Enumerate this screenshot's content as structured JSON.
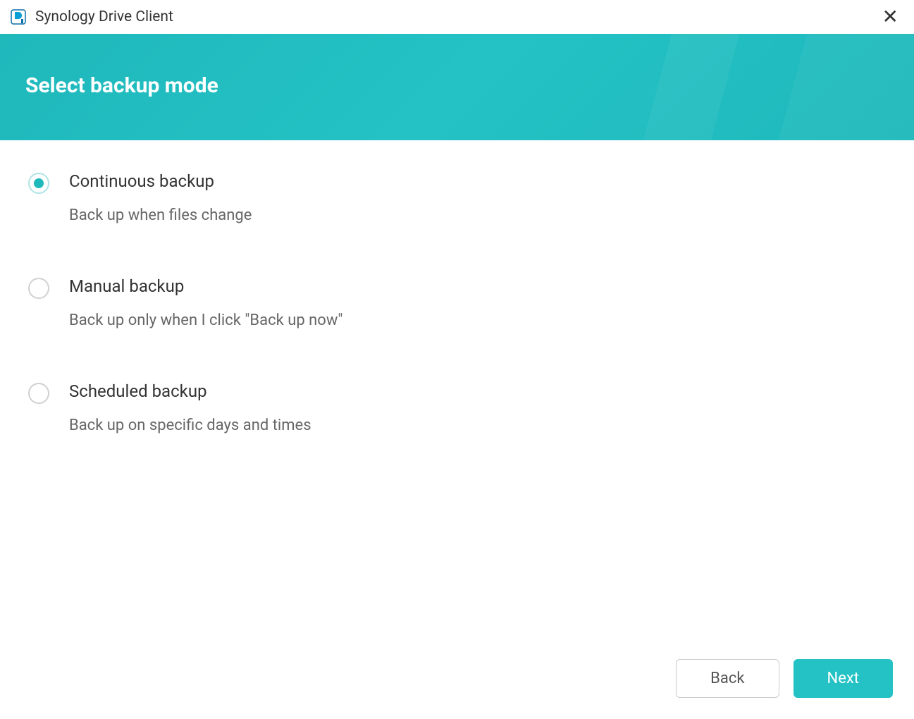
{
  "titlebar": {
    "app_title": "Synology Drive Client"
  },
  "header": {
    "title": "Select backup mode"
  },
  "options": [
    {
      "label": "Continuous backup",
      "description": "Back up when files change",
      "selected": true
    },
    {
      "label": "Manual backup",
      "description": "Back up only when I click \"Back up now\"",
      "selected": false
    },
    {
      "label": "Scheduled backup",
      "description": "Back up on specific days and times",
      "selected": false
    }
  ],
  "footer": {
    "back_label": "Back",
    "next_label": "Next"
  }
}
